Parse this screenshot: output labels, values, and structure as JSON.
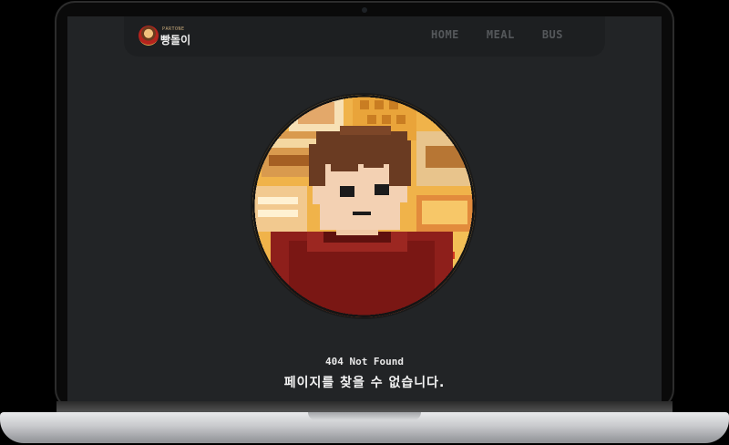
{
  "header": {
    "brand_small": "PARTONE",
    "brand_name": "빵돌이",
    "nav": [
      "HOME",
      "MEAL",
      "BUS"
    ]
  },
  "error": {
    "code": "404 Not Found",
    "message": "페이지를 찾을 수 없습니다."
  },
  "colors": {
    "screen_bg": "#222426",
    "navbar_bg": "#1d1f21",
    "nav_text": "#55585b",
    "text": "#f2f2f2",
    "sweater": "#8e1f1b",
    "bread": "#f3b74a"
  },
  "icons": [
    "brand-logo",
    "pixel-avatar-illustration"
  ]
}
